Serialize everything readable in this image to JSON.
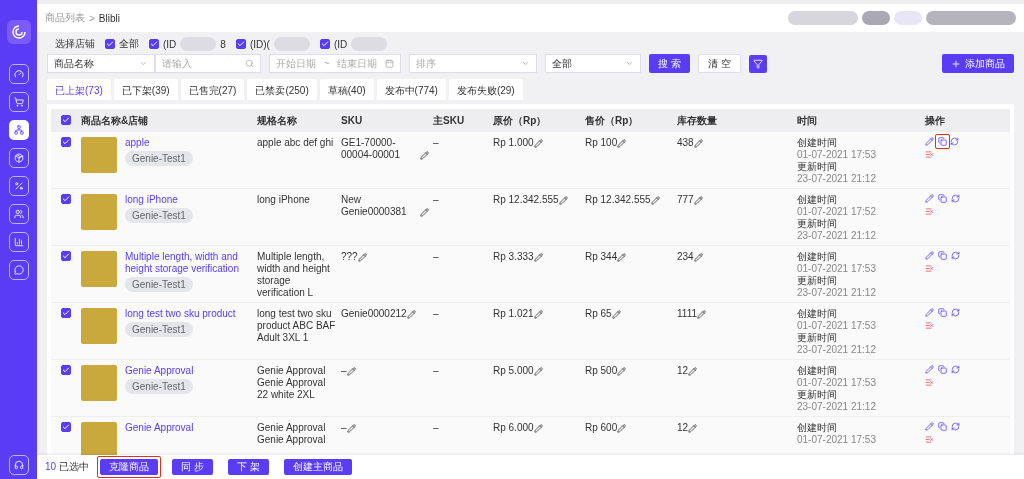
{
  "breadcrumb": {
    "parent": "商品列表",
    "separator": ">",
    "current": "Blibli"
  },
  "store_filter": {
    "label": "选择店铺",
    "stores": [
      {
        "label": "全部",
        "checked": true
      },
      {
        "label": "(ID",
        "suffix": "8",
        "checked": true
      },
      {
        "label": "(ID)(",
        "checked": true
      },
      {
        "label": "(ID",
        "checked": true
      }
    ]
  },
  "filters": {
    "field_select": "商品名称",
    "search_placeholder": "请输入",
    "start_date_placeholder": "开始日期",
    "date_separator": "~",
    "end_date_placeholder": "结束日期",
    "sort_placeholder": "排序",
    "status_select": "全部",
    "search_button": "搜 索",
    "clear_button": "清 空",
    "add_button": "添加商品"
  },
  "tabs": [
    {
      "label": "已上架(73)",
      "selected": true
    },
    {
      "label": "已下架(39)",
      "selected": false
    },
    {
      "label": "已售完(27)",
      "selected": false
    },
    {
      "label": "已禁卖(250)",
      "selected": false
    },
    {
      "label": "草稿(40)",
      "selected": false
    },
    {
      "label": "发布中(774)",
      "selected": false
    },
    {
      "label": "发布失败(29)",
      "selected": false
    }
  ],
  "table": {
    "all_checked": true,
    "columns": [
      "商品名称&店铺",
      "规格名称",
      "SKU",
      "主SKU",
      "原价（Rp）",
      "售价（Rp）",
      "库存数量",
      "时间",
      "操作"
    ],
    "rows": [
      {
        "name": "apple",
        "store": "Genie-Test1",
        "spec": "apple abc def ghi",
        "sku": "GE1-70000-00004-00001",
        "main_sku": "–",
        "original_price": "Rp 1.000",
        "sale_price": "Rp 100",
        "stock": "438",
        "created_label": "创建时间",
        "created": "01-07-2021 17:53",
        "updated_label": "更新时间",
        "updated": "23-07-2021 21:12",
        "checked": true,
        "copy_highlighted": true
      },
      {
        "name": "long iPhone",
        "store": "Genie-Test1",
        "spec": "long iPhone",
        "sku": "New Genie0000381",
        "main_sku": "–",
        "original_price": "Rp 12.342.555",
        "sale_price": "Rp 12.342.555",
        "stock": "777",
        "created_label": "创建时间",
        "created": "01-07-2021 17:52",
        "updated_label": "更新时间",
        "updated": "23-07-2021 21:12",
        "checked": true,
        "copy_highlighted": false
      },
      {
        "name": "Multiple length, width and height storage verification",
        "store": "Genie-Test1",
        "spec": "Multiple length, width and height storage verification L",
        "sku": "???",
        "main_sku": "–",
        "original_price": "Rp 3.333",
        "sale_price": "Rp 344",
        "stock": "234",
        "created_label": "创建时间",
        "created": "01-07-2021 17:53",
        "updated_label": "更新时间",
        "updated": "23-07-2021 21:12",
        "checked": true,
        "copy_highlighted": false
      },
      {
        "name": "long test two sku product",
        "store": "Genie-Test1",
        "spec": "long test two sku product ABC BAF Adult 3XL 1",
        "sku": "Genie0000212",
        "main_sku": "–",
        "original_price": "Rp 1.021",
        "sale_price": "Rp 65",
        "stock": "1111",
        "created_label": "创建时间",
        "created": "01-07-2021 17:53",
        "updated_label": "更新时间",
        "updated": "23-07-2021 21:12",
        "checked": true,
        "copy_highlighted": false
      },
      {
        "name": "Genie Approval",
        "store": "Genie-Test1",
        "spec": "Genie Approval Genie Approval 22 white 2XL",
        "sku": "–",
        "main_sku": "–",
        "original_price": "Rp 5.000",
        "sale_price": "Rp 500",
        "stock": "12",
        "created_label": "创建时间",
        "created": "01-07-2021 17:53",
        "updated_label": "更新时间",
        "updated": "23-07-2021 21:12",
        "checked": true,
        "copy_highlighted": false
      },
      {
        "name": "Genie Approval",
        "store": "",
        "spec": "Genie Approval Genie Approval",
        "sku": "–",
        "main_sku": "–",
        "original_price": "Rp 6.000",
        "sale_price": "Rp 600",
        "stock": "12",
        "created_label": "创建时间",
        "created": "01-07-2021 17:53",
        "checked": true,
        "copy_highlighted": false
      }
    ]
  },
  "footer": {
    "count": "10",
    "selected_label": "已选中",
    "buttons": [
      {
        "label": "克隆商品",
        "highlighted": true
      },
      {
        "label": "同 步",
        "highlighted": false
      },
      {
        "label": "下 架",
        "highlighted": false
      },
      {
        "label": "创建主商品",
        "highlighted": false
      }
    ]
  }
}
